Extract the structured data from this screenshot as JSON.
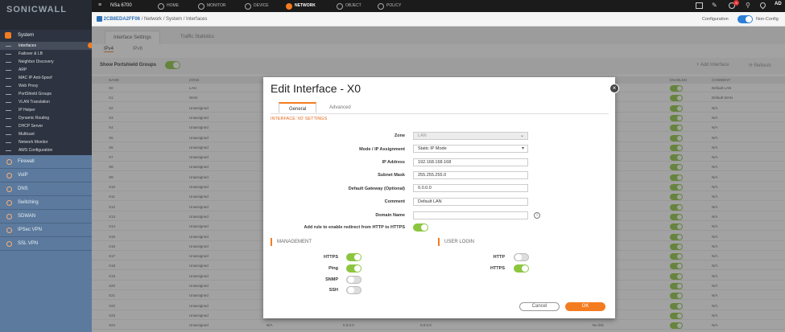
{
  "app": {
    "brand": "SONICWALL",
    "device": "NSa 6700"
  },
  "top_tabs": [
    {
      "label": "HOME",
      "icon": "home-icon"
    },
    {
      "label": "MONITOR",
      "icon": "monitor-icon"
    },
    {
      "label": "DEVICE",
      "icon": "device-icon"
    },
    {
      "label": "NETWORK",
      "icon": "network-icon"
    },
    {
      "label": "OBJECT",
      "icon": "object-icon"
    },
    {
      "label": "POLICY",
      "icon": "policy-icon"
    }
  ],
  "top_right": {
    "badge": "5",
    "user": "AD"
  },
  "subbar": {
    "serial": "2CB8EDA2FF06",
    "path": "/ Network / System / Interfaces",
    "config_label": "Configuration",
    "nonconfig_label": "Non-Config"
  },
  "sidebar": {
    "section": "System",
    "items": [
      "Interfaces",
      "Failover & LB",
      "Neighbor Discovery",
      "ARP",
      "MAC IP Anti-Spoof",
      "Web Proxy",
      "PortShield Groups",
      "VLAN Translation",
      "IP Helper",
      "Dynamic Routing",
      "DHCP Server",
      "Multicast",
      "Network Monitor",
      "AWS Configuration"
    ],
    "lower": [
      "Firewall",
      "VoIP",
      "DNS",
      "Switching",
      "SDWAN",
      "IPSec VPN",
      "SSL VPN"
    ]
  },
  "page_tabs": [
    "Interface Settings",
    "Traffic Statistics"
  ],
  "ip_tabs": [
    "IPv4",
    "IPv6"
  ],
  "portshield_label": "Show Portshield Groups",
  "actions": {
    "add": "Add Interface",
    "refresh": "Refresh"
  },
  "grid": {
    "headers": [
      "NAME",
      "ZONE",
      "ENABLED",
      "COMMENT"
    ],
    "rows": [
      {
        "name": "X0",
        "zone": "LAN",
        "duplex": "Duplex",
        "comment": "Default LAN"
      },
      {
        "name": "X1",
        "zone": "WAN",
        "duplex": "Duplex",
        "comment": "Default WAN"
      },
      {
        "name": "X2",
        "zone": "Unassigned",
        "duplex": "Duplex",
        "comment": "N/A"
      },
      {
        "name": "X3",
        "zone": "Unassigned",
        "duplex": "Duplex",
        "comment": "N/A"
      },
      {
        "name": "X4",
        "zone": "Unassigned",
        "duplex": "",
        "comment": "N/A"
      },
      {
        "name": "X5",
        "zone": "Unassigned",
        "duplex": "",
        "comment": "N/A"
      },
      {
        "name": "X6",
        "zone": "Unassigned",
        "duplex": "Duplex",
        "comment": "N/A"
      },
      {
        "name": "X7",
        "zone": "Unassigned",
        "duplex": "",
        "comment": "N/A"
      },
      {
        "name": "X8",
        "zone": "Unassigned",
        "duplex": "",
        "comment": "N/A"
      },
      {
        "name": "X9",
        "zone": "Unassigned",
        "duplex": "",
        "comment": "N/A"
      },
      {
        "name": "X10",
        "zone": "Unassigned",
        "duplex": "",
        "comment": "N/A"
      },
      {
        "name": "X11",
        "zone": "Unassigned",
        "duplex": "",
        "comment": "N/A"
      },
      {
        "name": "X12",
        "zone": "Unassigned",
        "duplex": "",
        "comment": "N/A"
      },
      {
        "name": "X13",
        "zone": "Unassigned",
        "duplex": "",
        "comment": "N/A"
      },
      {
        "name": "X14",
        "zone": "Unassigned",
        "duplex": "",
        "comment": "N/A"
      },
      {
        "name": "X15",
        "zone": "Unassigned",
        "duplex": "",
        "comment": "N/A"
      },
      {
        "name": "X16",
        "zone": "Unassigned",
        "duplex": "",
        "comment": "N/A"
      },
      {
        "name": "X17",
        "zone": "Unassigned",
        "duplex": "",
        "comment": "N/A"
      },
      {
        "name": "X18",
        "zone": "Unassigned",
        "duplex": "",
        "comment": "N/A"
      },
      {
        "name": "X19",
        "zone": "Unassigned",
        "duplex": "",
        "comment": "N/A"
      },
      {
        "name": "X20",
        "zone": "Unassigned",
        "duplex": "",
        "comment": "N/A"
      },
      {
        "name": "X21",
        "zone": "Unassigned",
        "duplex": "",
        "comment": "N/A"
      },
      {
        "name": "X22",
        "zone": "Unassigned",
        "duplex": "",
        "comment": "N/A"
      },
      {
        "name": "X23",
        "zone": "Unassigned",
        "duplex": "",
        "comment": "N/A"
      },
      {
        "name": "X24",
        "zone": "Unassigned",
        "duplex": "No link",
        "comment": "N/A",
        "ip": "N/A",
        "mask": "0.0.0.0",
        "gw": "0.0.0.0"
      }
    ]
  },
  "modal": {
    "title": "Edit Interface - X0",
    "tabs": [
      "General",
      "Advanced"
    ],
    "section": "INTERFACE 'X0' SETTINGS",
    "fields": [
      {
        "label": "Zone",
        "value": "LAN",
        "kind": "select-disabled"
      },
      {
        "label": "Mode / IP Assignment",
        "value": "Static IP Mode",
        "kind": "select"
      },
      {
        "label": "IP Address",
        "value": "192.168.168.168",
        "kind": "text"
      },
      {
        "label": "Subnet Mask",
        "value": "255.255.255.0",
        "kind": "text"
      },
      {
        "label": "Default Gateway (Optional)",
        "value": "0.0.0.0",
        "kind": "text"
      },
      {
        "label": "Comment",
        "value": "Default LAN",
        "kind": "text"
      },
      {
        "label": "Domain Name",
        "value": "",
        "kind": "text"
      }
    ],
    "redirect_label": "Add rule to enable redirect from HTTP to HTTPS",
    "management": {
      "title": "MANAGEMENT",
      "items": [
        {
          "label": "HTTPS",
          "on": true
        },
        {
          "label": "Ping",
          "on": true
        },
        {
          "label": "SNMP",
          "on": false
        },
        {
          "label": "SSH",
          "on": false
        }
      ]
    },
    "user_login": {
      "title": "USER LOGIN",
      "items": [
        {
          "label": "HTTP",
          "on": false
        },
        {
          "label": "HTTPS",
          "on": true
        }
      ]
    },
    "cancel": "Cancel",
    "ok": "OK",
    "close_glyph": "×"
  },
  "colors": {
    "accent": "#f47c20",
    "toggle_on": "#8cc63f",
    "sidebar": "#2d3340",
    "sidebar_lower": "#5b7a9d"
  }
}
